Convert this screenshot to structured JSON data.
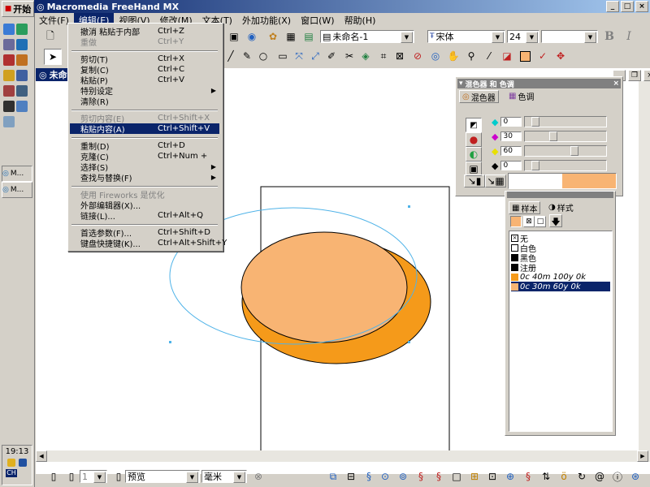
{
  "taskbar": {
    "start_label": "开始",
    "tasks": [
      "M...",
      "M..."
    ],
    "clock": "19:13",
    "lang": "CH"
  },
  "app": {
    "title": "Macromedia FreeHand MX",
    "doc_title": "未命名"
  },
  "menubar": {
    "items": [
      "文件(F)",
      "编辑(E)",
      "视图(V)",
      "修改(M)",
      "文本(T)",
      "外加功能(X)",
      "窗口(W)",
      "帮助(H)"
    ]
  },
  "toolbar": {
    "page_select": "未命名-1",
    "font": "宋体",
    "font_size": "24",
    "bold": "B",
    "italic": "I"
  },
  "edit_menu": {
    "items": [
      {
        "label": "撤消 粘贴于内部",
        "shortcut": "Ctrl+Z",
        "disabled": false
      },
      {
        "label": "重做",
        "shortcut": "Ctrl+Y",
        "disabled": true
      },
      {
        "label": "剪切(T)",
        "shortcut": "Ctrl+X",
        "disabled": false
      },
      {
        "label": "复制(C)",
        "shortcut": "Ctrl+C",
        "disabled": false
      },
      {
        "label": "粘贴(P)",
        "shortcut": "Ctrl+V",
        "disabled": false
      },
      {
        "label": "特别设定",
        "shortcut": "",
        "disabled": false,
        "submenu": true
      },
      {
        "label": "清除(R)",
        "shortcut": "",
        "disabled": false
      },
      {
        "label": "剪切内容(E)",
        "shortcut": "Ctrl+Shift+X",
        "disabled": true
      },
      {
        "label": "粘贴内容(A)",
        "shortcut": "Ctrl+Shift+V",
        "disabled": false,
        "highlight": true
      },
      {
        "label": "重制(D)",
        "shortcut": "Ctrl+D",
        "disabled": false
      },
      {
        "label": "克隆(C)",
        "shortcut": "Ctrl+Num +",
        "disabled": false
      },
      {
        "label": "选择(S)",
        "shortcut": "",
        "disabled": false,
        "submenu": true
      },
      {
        "label": "查找与替换(F)",
        "shortcut": "",
        "disabled": false,
        "submenu": true
      },
      {
        "label": "使用 Fireworks 是优化",
        "shortcut": "",
        "disabled": true
      },
      {
        "label": "外部编辑器(X)...",
        "shortcut": "",
        "disabled": false
      },
      {
        "label": "链接(L)...",
        "shortcut": "Ctrl+Alt+Q",
        "disabled": false
      },
      {
        "label": "首选参数(F)...",
        "shortcut": "Ctrl+Shift+D",
        "disabled": false
      },
      {
        "label": "键盘快捷键(K)...",
        "shortcut": "Ctrl+Alt+Shift+Y",
        "disabled": false
      }
    ]
  },
  "mixer_panel": {
    "title": "混色器 和 色调",
    "tabs": [
      "混色器",
      "色调"
    ],
    "values": [
      "0",
      "30",
      "60",
      "0"
    ],
    "channel_colors": [
      "#00cccc",
      "#cc00cc",
      "#e8e000",
      "#000000"
    ],
    "levels_percent": [
      0,
      30,
      60,
      0
    ],
    "preview_left": "#ffffff",
    "preview_right": "#f8b473"
  },
  "swatch_panel": {
    "tabs": [
      "样本",
      "样式"
    ],
    "items": [
      {
        "name": "无",
        "color": "none"
      },
      {
        "name": "白色",
        "color": "#ffffff"
      },
      {
        "name": "黑色",
        "color": "#000000"
      },
      {
        "name": "注册",
        "color": "#000000"
      },
      {
        "name": "0c 40m 100y 0k",
        "color": "#f59a1a",
        "italic": true
      },
      {
        "name": "0c 30m 60y 0k",
        "color": "#f8b473",
        "italic": true,
        "selected": true
      }
    ]
  },
  "statusbar": {
    "page_num": "1",
    "view_mode": "预览",
    "unit": "毫米"
  },
  "colors": {
    "orange": "#f59a1a",
    "light_orange": "#f8b473",
    "cyan_path": "#4fb3e8",
    "selection_blue": "#0a246a"
  }
}
